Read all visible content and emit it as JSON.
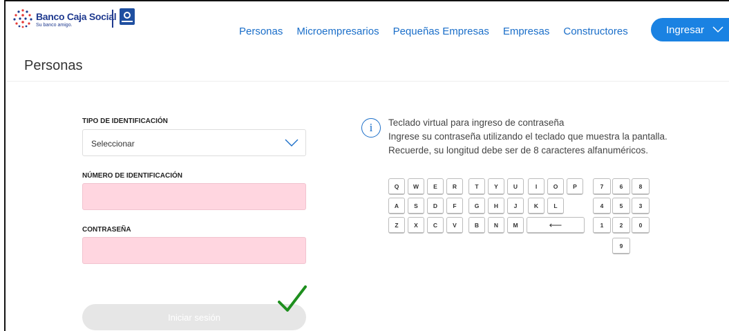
{
  "brand": {
    "name": "Banco Caja Social",
    "tagline": "Su banco amigo.",
    "color": "#1f3a8f"
  },
  "nav": {
    "items": [
      "Personas",
      "Microempresarios",
      "Pequeñas Empresas",
      "Empresas",
      "Constructores"
    ],
    "ingresar_label": "Ingresar"
  },
  "page": {
    "title": "Personas"
  },
  "form": {
    "id_type_label": "TIPO DE IDENTIFICACIÓN",
    "id_type_value": "Seleccionar",
    "id_number_label": "NÚMERO DE IDENTIFICACIÓN",
    "password_label": "CONTRASEÑA",
    "login_label": "Iniciar sesión"
  },
  "info": {
    "line1": "Teclado virtual para ingreso de contraseña",
    "line2": "Ingrese su contraseña utilizando el teclado que muestra la pantalla.",
    "line3": "Recuerde, su longitud debe ser de 8 caracteres alfanuméricos."
  },
  "keyboard": {
    "row1": [
      "Q",
      "W",
      "E",
      "R",
      "T",
      "Y",
      "U",
      "I",
      "O",
      "P"
    ],
    "row2": [
      "A",
      "S",
      "D",
      "F",
      "G",
      "H",
      "J",
      "K",
      "L"
    ],
    "row3": [
      "Z",
      "X",
      "C",
      "V",
      "B",
      "N",
      "M"
    ],
    "backspace": "⟵",
    "num_row1": [
      "7",
      "6",
      "8"
    ],
    "num_row2": [
      "4",
      "5",
      "3"
    ],
    "num_row3": [
      "1",
      "2",
      "0"
    ],
    "num_row4": [
      "9"
    ]
  },
  "colors": {
    "accent": "#1a82e2",
    "link": "#1a6ec9",
    "input_pink": "#ffd6e0",
    "check_green": "#1e8f1e"
  }
}
